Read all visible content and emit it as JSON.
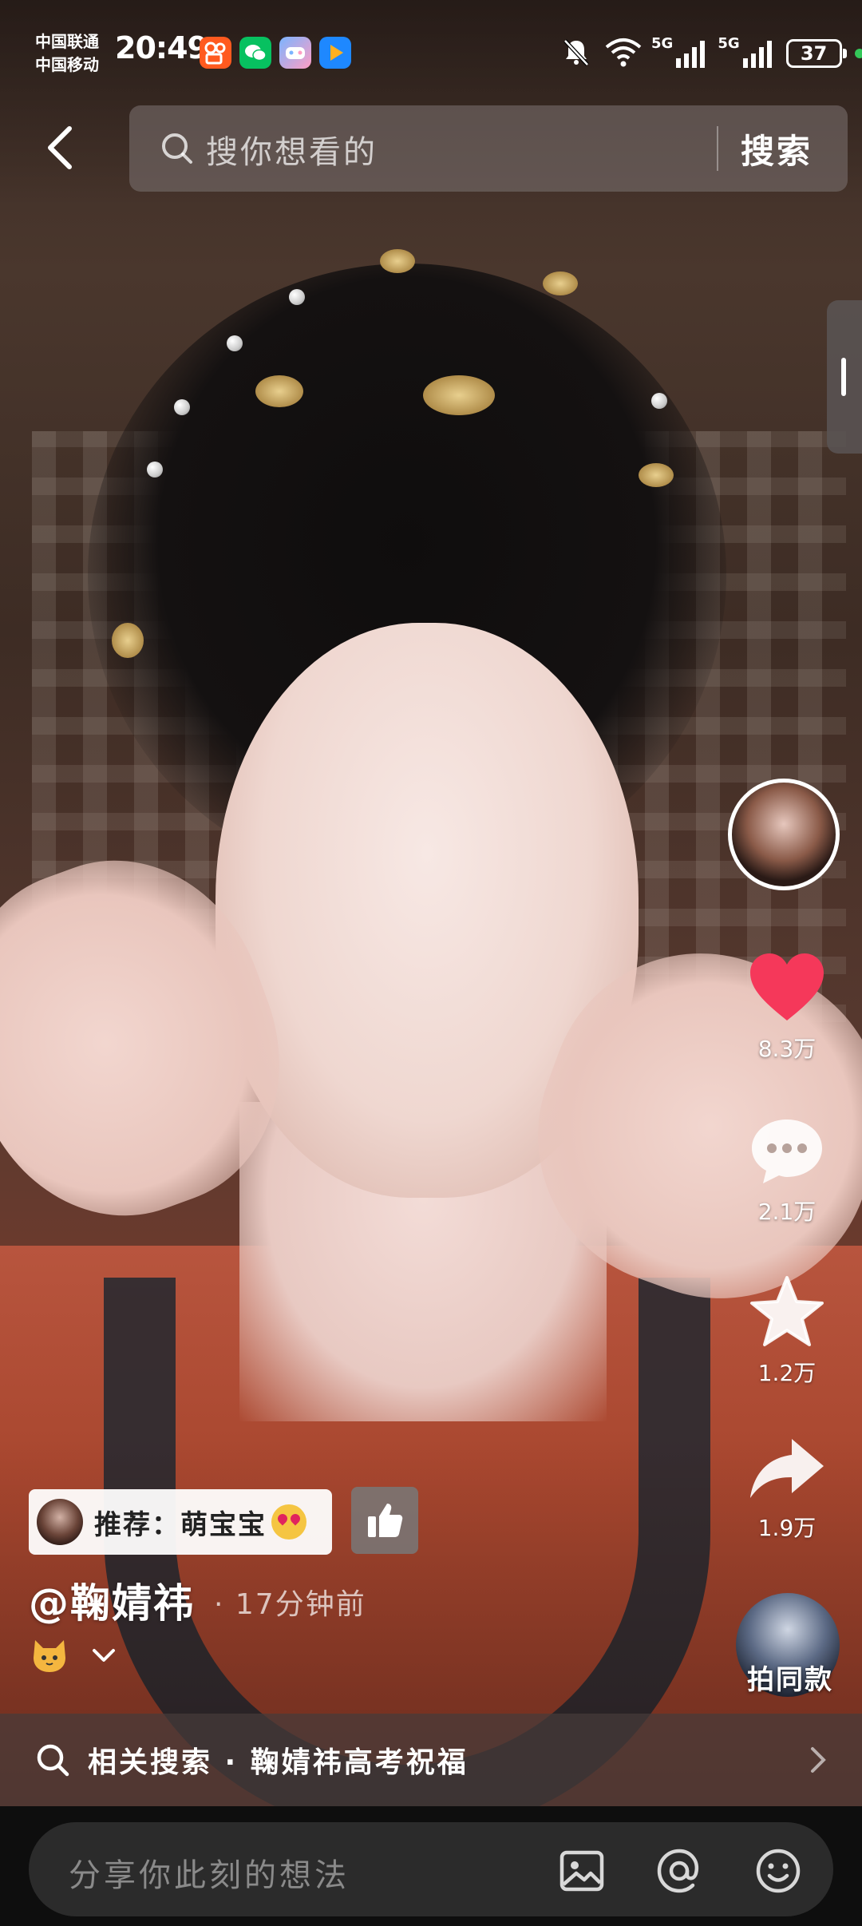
{
  "status_bar": {
    "carrier_1": "中国联通",
    "carrier_2": "中国移动",
    "time": "20:49",
    "network_1": "5G",
    "network_2": "5G",
    "battery": "37",
    "notification_icons": [
      "kuaishou-icon",
      "wechat-icon",
      "game-center-icon",
      "video-player-icon"
    ],
    "system_icons": [
      "mute-bell-icon",
      "wifi-icon",
      "signal-icon"
    ]
  },
  "search_bar": {
    "placeholder": "搜你想看的",
    "button_label": "搜索"
  },
  "actions": {
    "like_count": "8.3万",
    "comment_count": "2.1万",
    "favorite_count": "1.2万",
    "share_count": "1.9万",
    "same_style_label": "拍同款"
  },
  "post": {
    "recommend_text": "推荐：萌宝宝",
    "author": "@鞠婧祎",
    "time": "· 17分钟前"
  },
  "related_search": {
    "text": "相关搜索 · 鞠婧祎高考祝福"
  },
  "comment_bar": {
    "placeholder": "分享你此刻的想法"
  },
  "colors": {
    "like": "#f5385a",
    "chip_bg": "#ffffff",
    "status_green": "#34c759"
  }
}
